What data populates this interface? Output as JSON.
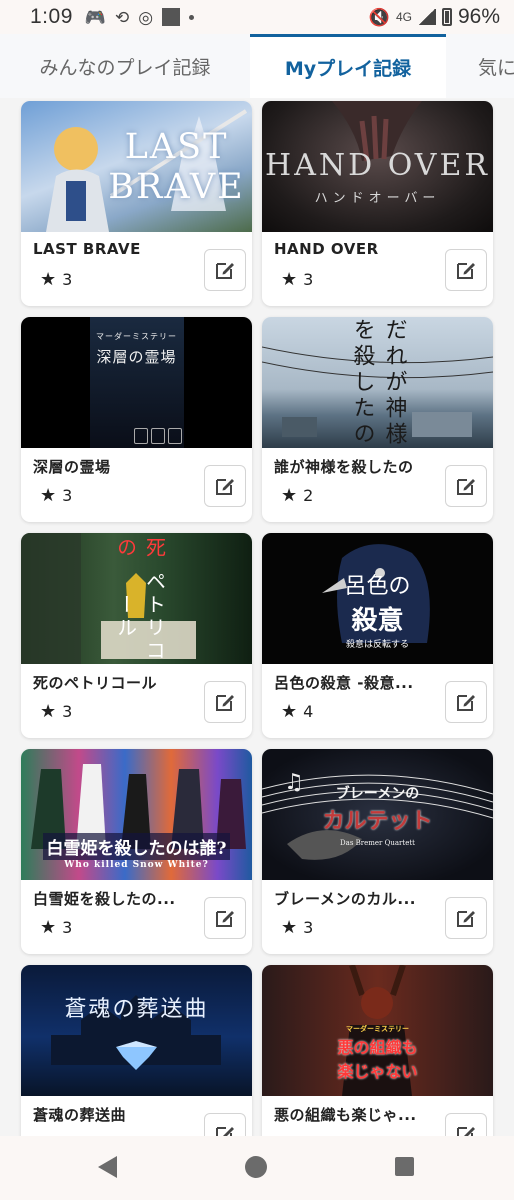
{
  "status_bar": {
    "time": "1:09",
    "network": "4G",
    "battery": "96%"
  },
  "tabs": [
    {
      "label": "みんなのプレイ記録",
      "active": false
    },
    {
      "label": "Myプレイ記録",
      "active": true
    },
    {
      "label": "気に",
      "active": false
    }
  ],
  "colors": {
    "accent": "#12629e",
    "card_bg": "#ffffff",
    "page_bg": "#f4f4f4"
  },
  "records": [
    {
      "title": "LAST BRAVE",
      "rating": "3",
      "art_text": [
        "LAST",
        "BRAVE"
      ],
      "art_sub": ""
    },
    {
      "title": "HAND OVER",
      "rating": "3",
      "art_text": [
        "HAND OVER"
      ],
      "art_sub": "ハンドオーバー"
    },
    {
      "title": "深層の霊場",
      "rating": "3",
      "art_text": [
        "マーダーミステリー",
        "深層の霊場"
      ],
      "art_sub": ""
    },
    {
      "title": "誰が神様を殺したの",
      "rating": "2",
      "art_text": [
        "だれが神様を殺したの"
      ],
      "art_sub": ""
    },
    {
      "title": "死のペトリコール",
      "rating": "3",
      "art_text": [
        "死の",
        "ペトリコール"
      ],
      "art_sub": ""
    },
    {
      "title": "呂色の殺意 -殺意...",
      "rating": "4",
      "art_text": [
        "呂色の",
        "殺意"
      ],
      "art_sub": "殺意は反転する"
    },
    {
      "title": "白雪姫を殺したの...",
      "rating": "3",
      "art_text": [
        "白雪姫を殺したのは誰?"
      ],
      "art_sub": "Who killed Snow White?"
    },
    {
      "title": "ブレーメンのカル...",
      "rating": "3",
      "art_text": [
        "ブレーメンの",
        "カルテット"
      ],
      "art_sub": "Das Bremer Quartett"
    },
    {
      "title": "蒼魂の葬送曲",
      "rating": "",
      "art_text": [
        "蒼魂の葬送曲"
      ],
      "art_sub": ""
    },
    {
      "title": "悪の組織も楽じゃ...",
      "rating": "",
      "art_text": [
        "悪の組織も",
        "楽じゃない"
      ],
      "art_sub": "マーダーミステリー"
    }
  ],
  "icons": {
    "rating": "star-icon",
    "edit": "edit-pencil-icon",
    "back": "back-triangle-icon",
    "home": "home-circle-icon",
    "recents": "recents-square-icon"
  }
}
